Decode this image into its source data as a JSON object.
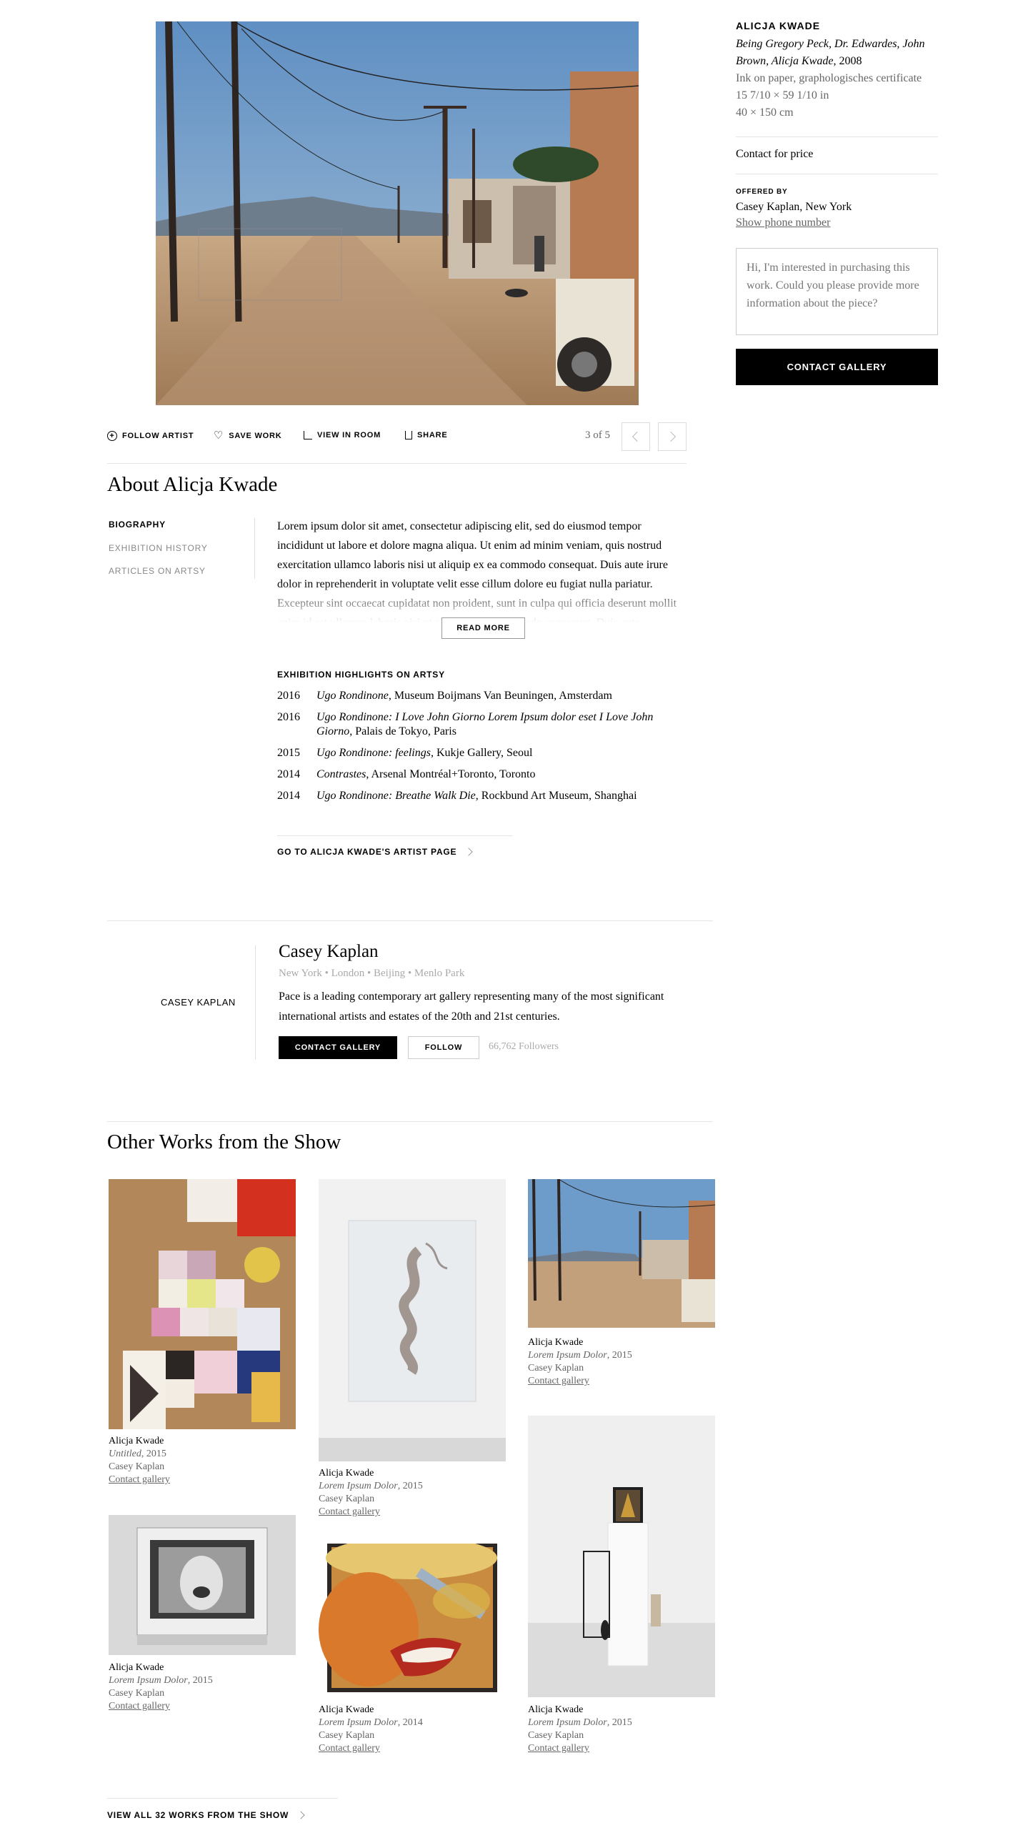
{
  "artwork": {
    "artist": "ALICJA KWADE",
    "title": "Being Gregory Peck, Dr. Edwardes, John Brown, Alicja Kwade",
    "year": "2008",
    "medium": "Ink on paper, graphologisches certificate",
    "dims_in": "15 7/10 × 59 1/10 in",
    "dims_cm": "40 × 150 cm",
    "price": "Contact for price",
    "offered_by_label": "OFFERED BY",
    "gallery": "Casey Kaplan, New York",
    "phone_link": "Show phone number",
    "message_placeholder": "Hi, I'm interested in purchasing this work. Could you please provide more information about the piece?",
    "contact_button": "CONTACT GALLERY"
  },
  "toolbar": {
    "follow": "FOLLOW ARTIST",
    "save": "SAVE WORK",
    "view_in_room": "VIEW IN ROOM",
    "share": "SHARE",
    "pager": "3 of 5"
  },
  "about": {
    "heading": "About Alicja Kwade",
    "tabs": [
      "BIOGRAPHY",
      "EXHIBITION HISTORY",
      "ARTICLES ON ARTSY"
    ],
    "bio": "Lorem ipsum dolor sit amet, consectetur adipiscing elit, sed do eiusmod tempor incididunt ut labore et dolore magna aliqua. Ut enim ad minim veniam, quis nostrud exercitation ullamco laboris nisi ut aliquip ex ea commodo consequat. Duis aute irure dolor in reprehenderit in voluptate velit esse cillum dolore eu fugiat nulla pariatur. Excepteur sint occaecat cupidatat non proident, sunt in culpa qui officia deserunt mollit anim id est ullamco laboris nisi ut aliquip ex ea commodo consequat. Duis aute",
    "read_more": "READ MORE",
    "highlights_heading": "EXHIBITION HIGHLIGHTS ON ARTSY",
    "highlights": [
      {
        "year": "2016",
        "title": "Ugo Rondinone",
        "venue": ", Museum Boijmans Van Beuningen, Amsterdam"
      },
      {
        "year": "2016",
        "title": "Ugo Rondinone: I Love John Giorno Lorem Ipsum dolor eset I Love John Giorno",
        "venue": ", Palais de Tokyo, Paris"
      },
      {
        "year": "2015",
        "title": "Ugo Rondinone: feelings",
        "venue": ", Kukje Gallery, Seoul"
      },
      {
        "year": "2014",
        "title": "Contrastes",
        "venue": ", Arsenal Montréal+Toronto, Toronto"
      },
      {
        "year": "2014",
        "title": "Ugo Rondinone: Breathe Walk Die",
        "venue": ", Rockbund Art Museum, Shanghai"
      }
    ],
    "artist_page_link": "GO TO ALICJA KWADE'S ARTIST PAGE"
  },
  "gallery_card": {
    "logo_text": "CASEY KAPLAN",
    "name": "Casey Kaplan",
    "locations": "New York • London • Beijing • Menlo Park",
    "description": "Pace is a leading contemporary art gallery representing many of the most significant international artists and estates of the 20th and 21st centuries.",
    "contact_button": "CONTACT GALLERY",
    "follow_button": "FOLLOW",
    "followers": "66,762 Followers"
  },
  "other_works": {
    "heading": "Other Works from the Show",
    "items": [
      {
        "artist": "Alicja Kwade",
        "title": "Untitled",
        "year": ", 2015",
        "gallery": "Casey Kaplan",
        "link": "Contact gallery"
      },
      {
        "artist": "Alicja Kwade",
        "title": "Lorem Ipsum Dolor",
        "year": ", 2015",
        "gallery": "Casey Kaplan",
        "link": "Contact gallery"
      },
      {
        "artist": "Alicja Kwade",
        "title": "Lorem Ipsum Dolor",
        "year": ", 2015",
        "gallery": "Casey Kaplan",
        "link": "Contact gallery"
      },
      {
        "artist": "Alicja Kwade",
        "title": "Lorem Ipsum Dolor",
        "year": ", 2015",
        "gallery": "Casey Kaplan",
        "link": "Contact gallery"
      },
      {
        "artist": "Alicja Kwade",
        "title": "Lorem Ipsum Dolor",
        "year": ", 2014",
        "gallery": "Casey Kaplan",
        "link": "Contact gallery"
      },
      {
        "artist": "Alicja Kwade",
        "title": "Lorem Ipsum Dolor",
        "year": ", 2015",
        "gallery": "Casey Kaplan",
        "link": "Contact gallery"
      }
    ],
    "view_all": "VIEW ALL 32 WORKS FROM THE SHOW"
  }
}
